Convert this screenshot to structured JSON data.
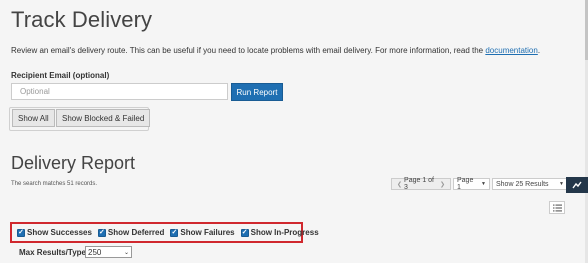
{
  "page": {
    "title": "Track Delivery",
    "intro_text": "Review an email's delivery route. This can be useful if you need to locate problems with email delivery. For more information, read the ",
    "intro_link": "documentation",
    "intro_tail": "."
  },
  "form": {
    "recipient_label": "Recipient Email (optional)",
    "recipient_placeholder": "Optional",
    "recipient_value": "",
    "run_report_label": "Run Report",
    "show_all_label": "Show All",
    "show_blocked_label": "Show Blocked & Failed"
  },
  "report": {
    "title": "Delivery Report",
    "match_text": "The search matches 51 records.",
    "pager_label": "Page 1 of 3",
    "page_select": "Page 1",
    "page_size": "Show 25 Results"
  },
  "filters": [
    {
      "label": "Show Successes",
      "checked": true
    },
    {
      "label": "Show Deferred",
      "checked": true
    },
    {
      "label": "Show Failures",
      "checked": true
    },
    {
      "label": "Show In-Progress",
      "checked": true
    }
  ],
  "max_results": {
    "label": "Max Results/Type:",
    "value": "250"
  },
  "icons": {
    "side_tab": "chart-icon",
    "list_toggle": "list-icon"
  },
  "colors": {
    "accent": "#1f6fb2",
    "highlight_border": "#d0282e",
    "side_tab": "#24374a"
  }
}
